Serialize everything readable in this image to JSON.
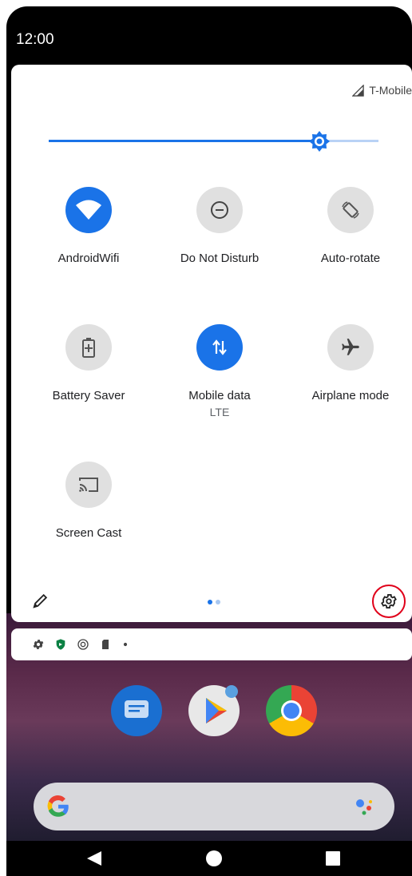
{
  "status_bar": {
    "time": "12:00"
  },
  "quick_settings": {
    "carrier": "T-Mobile",
    "brightness_level": 0.82,
    "tiles": [
      {
        "label": "AndroidWifi",
        "sublabel": "",
        "active": true,
        "icon": "wifi-icon"
      },
      {
        "label": "Do Not Disturb",
        "sublabel": "",
        "active": false,
        "icon": "do-not-disturb-icon"
      },
      {
        "label": "Auto-rotate",
        "sublabel": "",
        "active": false,
        "icon": "auto-rotate-icon"
      },
      {
        "label": "Battery Saver",
        "sublabel": "",
        "active": false,
        "icon": "battery-saver-icon"
      },
      {
        "label": "Mobile data",
        "sublabel": "LTE",
        "active": true,
        "icon": "mobile-data-icon"
      },
      {
        "label": "Airplane mode",
        "sublabel": "",
        "active": false,
        "icon": "airplane-icon"
      },
      {
        "label": "Screen Cast",
        "sublabel": "",
        "active": false,
        "icon": "screen-cast-icon"
      }
    ],
    "page_indicator": {
      "pages": 2,
      "current": 1
    }
  },
  "colors": {
    "accent": "#1a73e8",
    "tile_off": "#e0e0e0",
    "highlight_ring": "#e0001a"
  }
}
